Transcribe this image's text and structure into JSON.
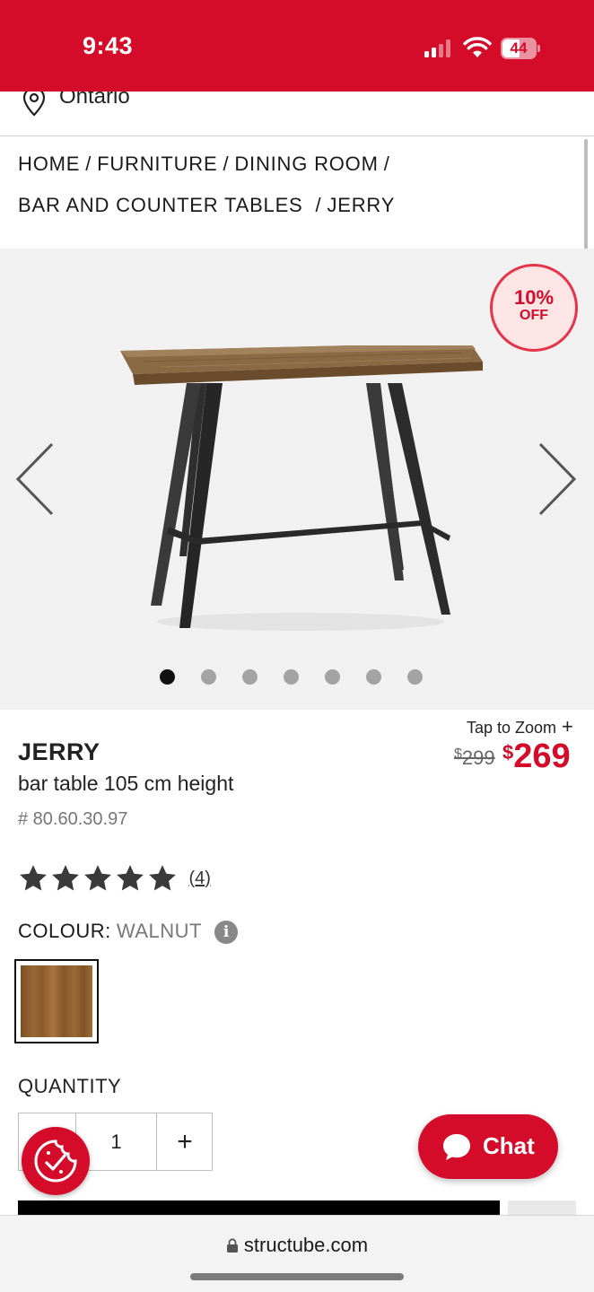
{
  "status_bar": {
    "time": "9:43",
    "battery": "44"
  },
  "location": {
    "label": "Ontario"
  },
  "breadcrumb": {
    "items": [
      "HOME",
      "FURNITURE",
      "DINING ROOM",
      "BAR AND COUNTER TABLES",
      "JERRY"
    ],
    "separator": "/"
  },
  "gallery": {
    "discount_percent": "10%",
    "discount_suffix": "OFF",
    "image_count": 7,
    "active_index": 0
  },
  "product": {
    "zoom_label": "Tap to Zoom",
    "zoom_icon": "+",
    "name": "JERRY",
    "description": "bar table 105 cm height",
    "sku": "# 80.60.30.97",
    "currency": "$",
    "price_original": "299",
    "price_sale": "269",
    "rating_stars": 5,
    "review_count": "(4)",
    "colour_label": "COLOUR:",
    "colour_value": "WALNUT",
    "info_icon": "i"
  },
  "quantity": {
    "label": "QUANTITY",
    "value": "1",
    "plus": "+"
  },
  "chat": {
    "label": "Chat"
  },
  "browser": {
    "url": "structube.com"
  },
  "colors": {
    "brand_red": "#d40c2a",
    "gallery_bg": "#f1f1f1",
    "text_dark": "#222222",
    "text_muted": "#777777"
  }
}
